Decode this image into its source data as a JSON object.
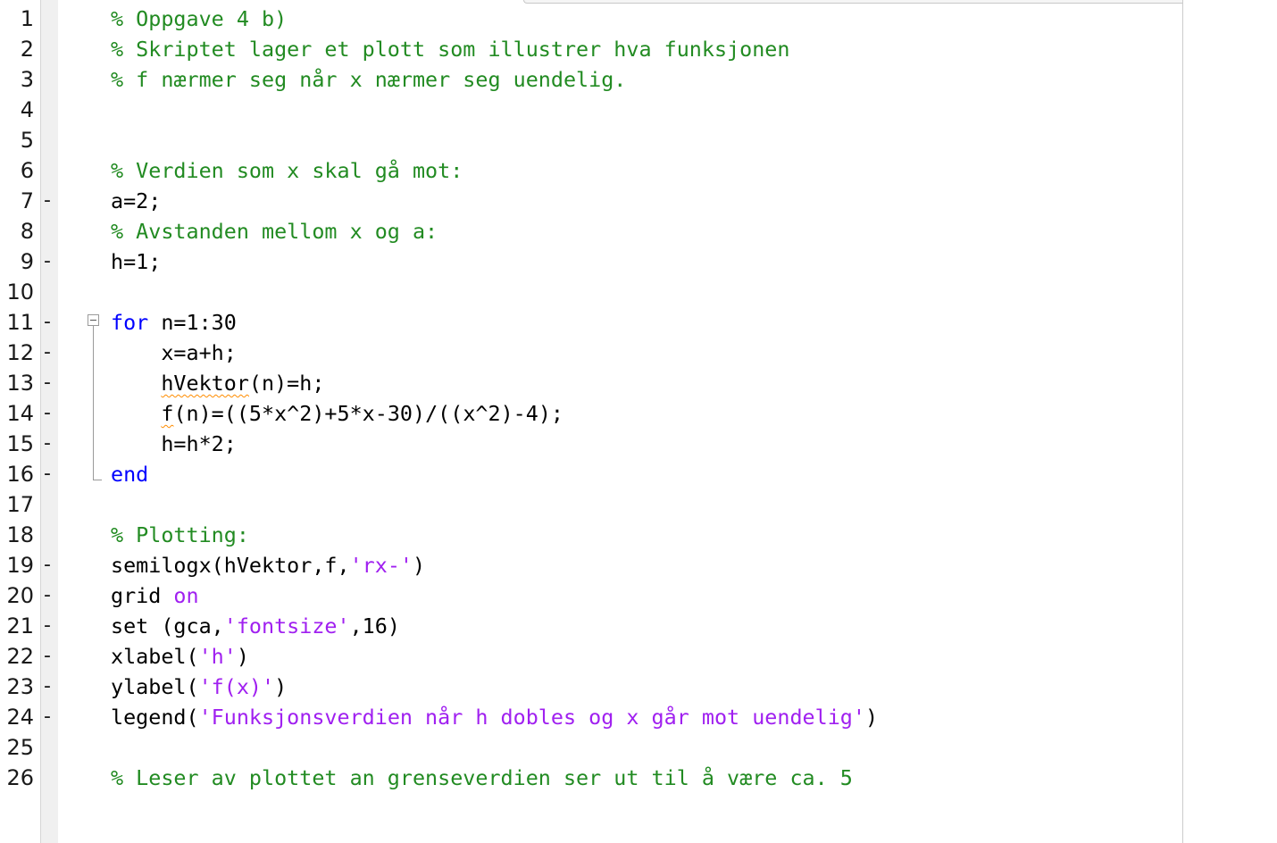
{
  "editor": {
    "lines": [
      {
        "num": "1",
        "dash": "",
        "segs": [
          {
            "t": "% Oppgave 4 b)",
            "c": "comment"
          }
        ]
      },
      {
        "num": "2",
        "dash": "",
        "segs": [
          {
            "t": "% Skriptet lager et plott som illustrer hva funksjonen",
            "c": "comment"
          }
        ]
      },
      {
        "num": "3",
        "dash": "",
        "segs": [
          {
            "t": "% f nærmer seg når x nærmer seg uendelig.",
            "c": "comment"
          }
        ]
      },
      {
        "num": "4",
        "dash": "",
        "segs": []
      },
      {
        "num": "5",
        "dash": "",
        "segs": []
      },
      {
        "num": "6",
        "dash": "",
        "segs": [
          {
            "t": "% Verdien som x skal gå mot:",
            "c": "comment"
          }
        ]
      },
      {
        "num": "7",
        "dash": "-",
        "segs": [
          {
            "t": "a=2;",
            "c": "plain"
          }
        ]
      },
      {
        "num": "8",
        "dash": "",
        "segs": [
          {
            "t": "% Avstanden mellom x og a:",
            "c": "comment"
          }
        ]
      },
      {
        "num": "9",
        "dash": "-",
        "segs": [
          {
            "t": "h=1;",
            "c": "plain"
          }
        ]
      },
      {
        "num": "10",
        "dash": "",
        "segs": []
      },
      {
        "num": "11",
        "dash": "-",
        "segs": [
          {
            "t": "for",
            "c": "kw"
          },
          {
            "t": " n=1:30",
            "c": "plain"
          }
        ]
      },
      {
        "num": "12",
        "dash": "-",
        "segs": [
          {
            "t": "    x=a+h;",
            "c": "plain"
          }
        ]
      },
      {
        "num": "13",
        "dash": "-",
        "segs": [
          {
            "t": "    ",
            "c": "plain"
          },
          {
            "t": "hVektor",
            "c": "warn"
          },
          {
            "t": "(n)=h;",
            "c": "plain"
          }
        ]
      },
      {
        "num": "14",
        "dash": "-",
        "segs": [
          {
            "t": "    ",
            "c": "plain"
          },
          {
            "t": "f",
            "c": "warn"
          },
          {
            "t": "(n)=((5*x^2)+5*x-30)/((x^2)-4);",
            "c": "plain"
          }
        ]
      },
      {
        "num": "15",
        "dash": "-",
        "segs": [
          {
            "t": "    h=h*2;",
            "c": "plain"
          }
        ]
      },
      {
        "num": "16",
        "dash": "-",
        "segs": [
          {
            "t": "end",
            "c": "kw"
          }
        ]
      },
      {
        "num": "17",
        "dash": "",
        "segs": []
      },
      {
        "num": "18",
        "dash": "",
        "segs": [
          {
            "t": "% Plotting:",
            "c": "comment"
          }
        ]
      },
      {
        "num": "19",
        "dash": "-",
        "segs": [
          {
            "t": "semilogx(hVektor,f,",
            "c": "plain"
          },
          {
            "t": "'rx-'",
            "c": "str"
          },
          {
            "t": ")",
            "c": "plain"
          }
        ]
      },
      {
        "num": "20",
        "dash": "-",
        "segs": [
          {
            "t": "grid ",
            "c": "plain"
          },
          {
            "t": "on",
            "c": "str"
          }
        ]
      },
      {
        "num": "21",
        "dash": "-",
        "segs": [
          {
            "t": "set (gca,",
            "c": "plain"
          },
          {
            "t": "'fontsize'",
            "c": "str"
          },
          {
            "t": ",16)",
            "c": "plain"
          }
        ]
      },
      {
        "num": "22",
        "dash": "-",
        "segs": [
          {
            "t": "xlabel(",
            "c": "plain"
          },
          {
            "t": "'h'",
            "c": "str"
          },
          {
            "t": ")",
            "c": "plain"
          }
        ]
      },
      {
        "num": "23",
        "dash": "-",
        "segs": [
          {
            "t": "ylabel(",
            "c": "plain"
          },
          {
            "t": "'f(x)'",
            "c": "str"
          },
          {
            "t": ")",
            "c": "plain"
          }
        ]
      },
      {
        "num": "24",
        "dash": "-",
        "segs": [
          {
            "t": "legend(",
            "c": "plain"
          },
          {
            "t": "'Funksjonsverdien når h dobles og x går mot uendelig'",
            "c": "str"
          },
          {
            "t": ")",
            "c": "plain"
          }
        ]
      },
      {
        "num": "25",
        "dash": "",
        "segs": []
      },
      {
        "num": "26",
        "dash": "",
        "segs": [
          {
            "t": "% Leser av plottet an grenseverdien ser ut til å være ca. 5",
            "c": "comment"
          }
        ]
      }
    ]
  },
  "colors": {
    "comment": "#228b22",
    "keyword": "#0000ff",
    "string": "#a020f0",
    "warning_underline": "#ff8c00"
  },
  "icons": {
    "fold": "minus-box-icon"
  }
}
